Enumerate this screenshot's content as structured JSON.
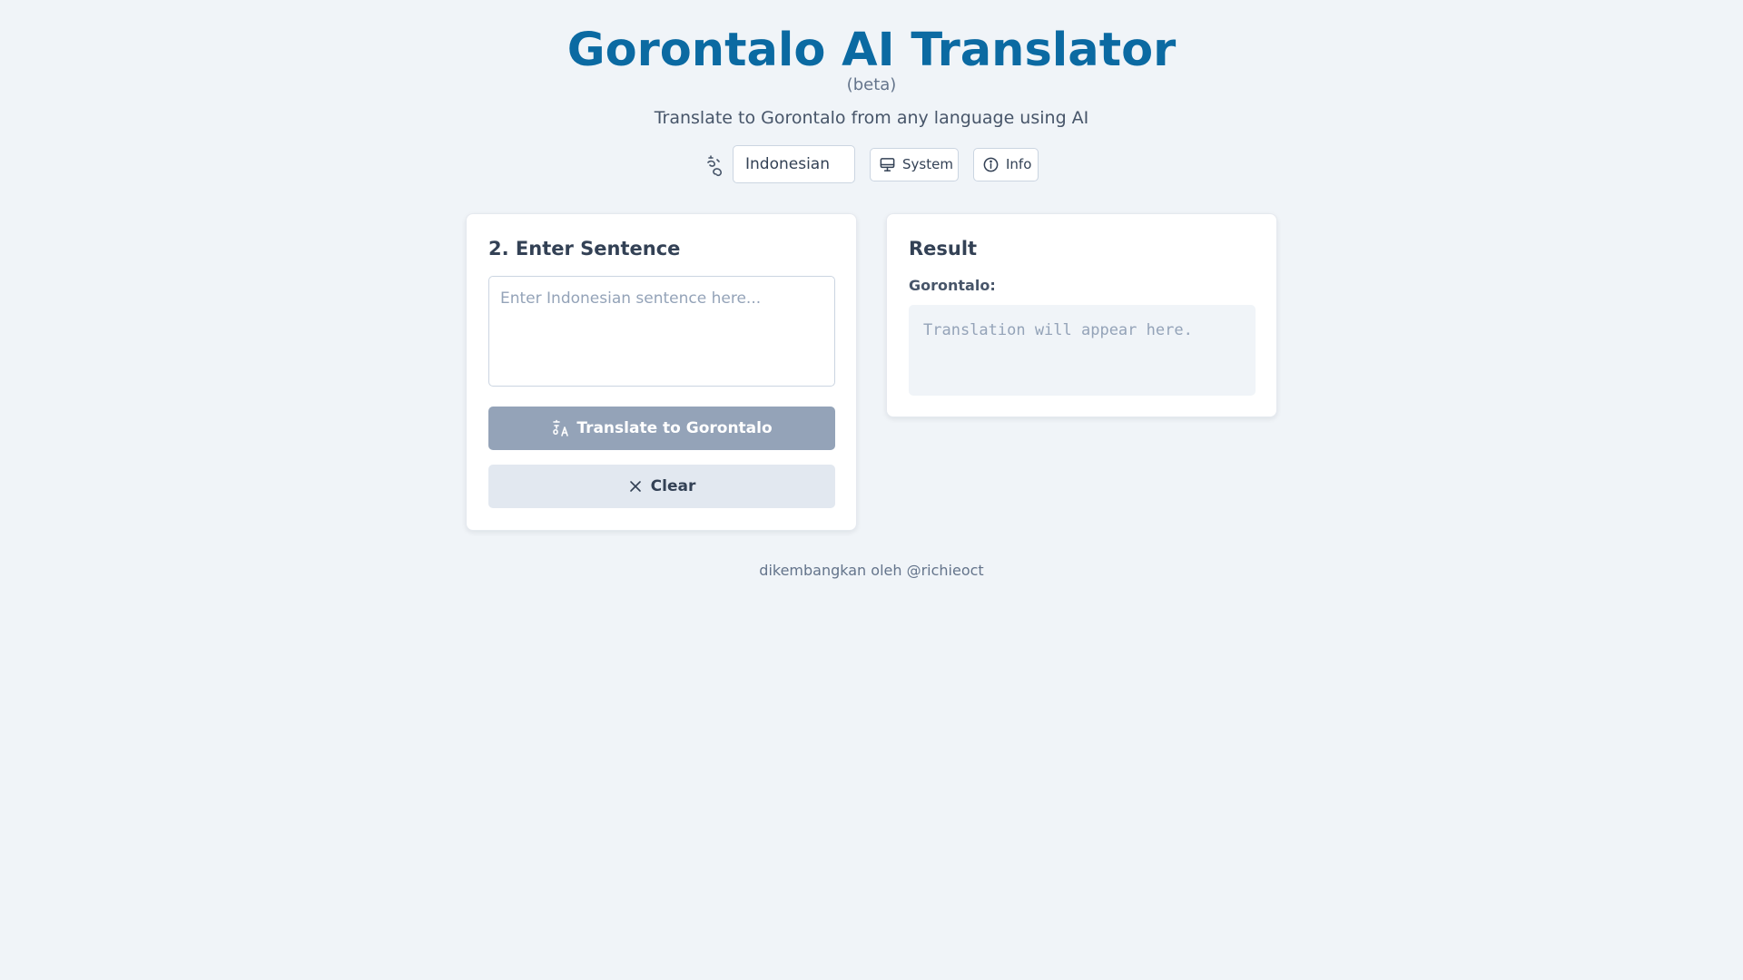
{
  "header": {
    "title": "Gorontalo AI Translator",
    "beta": "(beta)",
    "subtitle": "Translate to Gorontalo from any language using AI"
  },
  "controls": {
    "language_icon": "translate-icon",
    "selected_language": "Indonesian",
    "system_label": "System",
    "system_icon": "monitor-icon",
    "info_label": "Info",
    "info_icon": "info-icon"
  },
  "input_card": {
    "title": "2. Enter Sentence",
    "placeholder": "Enter Indonesian sentence here...",
    "value": "",
    "translate_label": "Translate to Gorontalo",
    "translate_icon": "translate-icon",
    "clear_label": "Clear",
    "clear_icon": "close-icon"
  },
  "result_card": {
    "title": "Result",
    "label": "Gorontalo:",
    "placeholder": "Translation will appear here."
  },
  "footer": {
    "text": "dikembangkan oleh @richieoct"
  },
  "colors": {
    "background": "#f0f4f8",
    "title": "#0b6aa2",
    "translate_button_disabled": "#94a3b8",
    "clear_button": "#e2e8f0"
  }
}
